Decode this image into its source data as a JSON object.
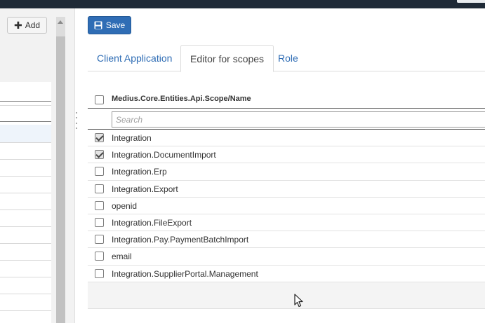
{
  "left_panel": {
    "add_label": "Add",
    "add_icon": "plus-icon"
  },
  "toolbar": {
    "save_label": "Save",
    "save_icon": "floppy-disk-icon"
  },
  "tabs": [
    {
      "label": "Client Application",
      "active": false
    },
    {
      "label": "Editor for scopes",
      "active": true
    },
    {
      "label": "Role",
      "active": false
    }
  ],
  "grid": {
    "column_title": "Medius.Core.Entities.Api.Scope/Name",
    "search_placeholder": "Search",
    "rows": [
      {
        "label": "Integration",
        "checked": true
      },
      {
        "label": "Integration.DocumentImport",
        "checked": true
      },
      {
        "label": "Integration.Erp",
        "checked": false
      },
      {
        "label": "Integration.Export",
        "checked": false
      },
      {
        "label": "openid",
        "checked": false
      },
      {
        "label": "Integration.FileExport",
        "checked": false
      },
      {
        "label": "Integration.Pay.PaymentBatchImport",
        "checked": false
      },
      {
        "label": "email",
        "checked": false
      },
      {
        "label": "Integration.SupplierPortal.Management",
        "checked": false
      }
    ]
  },
  "colors": {
    "accent": "#2f6db5",
    "topbar": "#1f2a37"
  }
}
